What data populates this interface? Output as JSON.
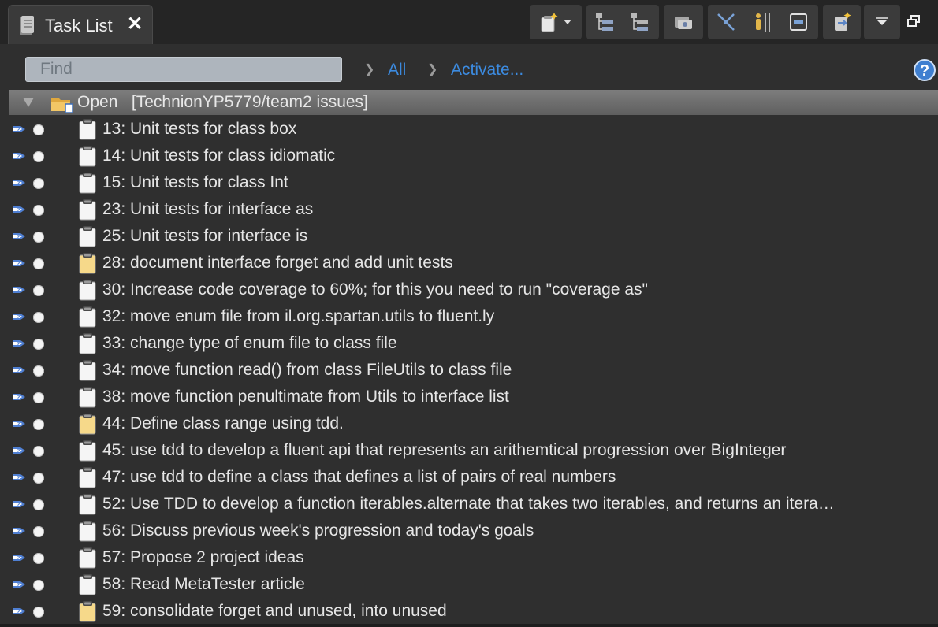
{
  "view": {
    "title": "Task List",
    "close_glyph": "✕"
  },
  "toolbar": {
    "buttons": [
      {
        "name": "new-task-icon"
      },
      {
        "name": "dropdown-arrow-icon"
      },
      {
        "name": "categorized-icon"
      },
      {
        "name": "scheduled-icon"
      },
      {
        "name": "synchronize-icon"
      },
      {
        "name": "focus-on-workweek-icon"
      },
      {
        "name": "presentation-icon"
      },
      {
        "name": "collapse-all-icon"
      },
      {
        "name": "link-with-editor-icon"
      },
      {
        "name": "view-menu-icon"
      }
    ]
  },
  "filter": {
    "find_placeholder": "Find",
    "all_label": "All",
    "activate_label": "Activate..."
  },
  "group": {
    "label": "Open   [TechnionYP5779/team2 issues]"
  },
  "tasks": [
    {
      "label": "13: Unit tests for class box",
      "icon_color": "#f5f5f5"
    },
    {
      "label": "14: Unit tests for class idiomatic",
      "icon_color": "#f5f5f5"
    },
    {
      "label": "15: Unit tests for class Int",
      "icon_color": "#f5f5f5"
    },
    {
      "label": "23: Unit tests for interface as",
      "icon_color": "#f5f5f5"
    },
    {
      "label": "25: Unit tests for interface is",
      "icon_color": "#f5f5f5"
    },
    {
      "label": "28: document interface forget and add unit tests",
      "icon_color": "#f6d98a"
    },
    {
      "label": "30: Increase code coverage to 60%; for this you need to run \"coverage as\"",
      "icon_color": "#f5f5f5"
    },
    {
      "label": "32: move enum file from il.org.spartan.utils to fluent.ly",
      "icon_color": "#f5f5f5"
    },
    {
      "label": "33: change type of enum file to class file",
      "icon_color": "#f5f5f5"
    },
    {
      "label": "34: move function read() from class FileUtils to class file",
      "icon_color": "#f5f5f5"
    },
    {
      "label": "38: move function penultimate from Utils to interface list",
      "icon_color": "#f5f5f5"
    },
    {
      "label": "44: Define class range using tdd.",
      "icon_color": "#f6d98a"
    },
    {
      "label": "45: use tdd to develop a fluent api that represents an arithemtical progression over BigInteger",
      "icon_color": "#f5f5f5"
    },
    {
      "label": "47: use tdd to define a class that defines a list of pairs of real numbers",
      "icon_color": "#f5f5f5"
    },
    {
      "label": "52: Use TDD to develop a function iterables.alternate that takes two iterables, and returns an itera…",
      "icon_color": "#f5f5f5"
    },
    {
      "label": "56: Discuss previous week's progression and today's goals",
      "icon_color": "#f5f5f5"
    },
    {
      "label": "57: Propose 2 project ideas",
      "icon_color": "#f5f5f5"
    },
    {
      "label": "58: Read MetaTester article",
      "icon_color": "#f5f5f5"
    },
    {
      "label": "59: consolidate forget and unused, into unused",
      "icon_color": "#f6d98a"
    }
  ]
}
